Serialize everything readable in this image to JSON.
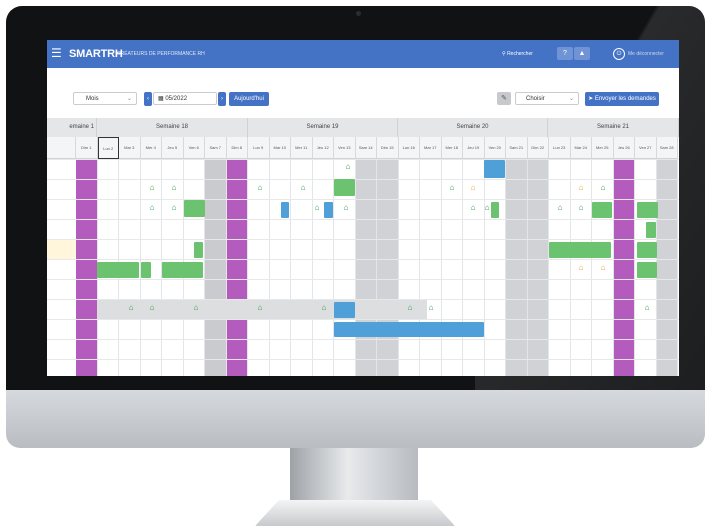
{
  "app": {
    "logo": "SMARTRH",
    "tagline": "CRÉATEURS DE PERFORMANCE RH",
    "search_label": "Rechercher",
    "help_label": "?",
    "bell_icon": "bell-icon",
    "logout_label": "Me déconnecter"
  },
  "toolbar": {
    "view_select": "Mois",
    "prev": "‹",
    "date_value": "05/2022",
    "next": "›",
    "today_button": "Aujourd'hui",
    "choose_select": "Choisir",
    "send_button": "Envoyer les demandes"
  },
  "colors": {
    "accent": "#4472c4",
    "green": "#6cc36f",
    "blue": "#4f9fd9",
    "purple": "#b45cbe",
    "grey": "#c9cbce"
  },
  "weeks": [
    "emaine 1",
    "Semaine 18",
    "Semaine 19",
    "Semaine 20",
    "Semaine 21"
  ],
  "days": [
    "Dim 1",
    "Lun 2",
    "Mar 3",
    "Mer 4",
    "Jeu 5",
    "Ven 6",
    "Sam 7",
    "Dim 8",
    "Lun 9",
    "Mar 10",
    "Mer 11",
    "Jeu 12",
    "Ven 13",
    "Sam 14",
    "Dim 15",
    "Lun 16",
    "Mar 17",
    "Mer 18",
    "Jeu 19",
    "Ven 20",
    "Sam 21",
    "Dim 22",
    "Lun 23",
    "Mar 24",
    "Mer 25",
    "Jeu 26",
    "Ven 27",
    "Sam 28"
  ]
}
